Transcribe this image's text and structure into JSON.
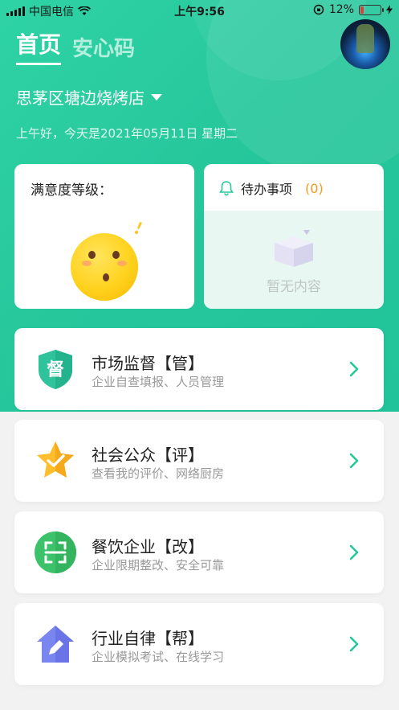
{
  "status_bar": {
    "carrier": "中国电信",
    "time": "上午9:56",
    "battery_pct": "12%"
  },
  "nav": {
    "home_label": "首页",
    "code_label": "安心码"
  },
  "header": {
    "store_name": "思茅区塘边烧烤店",
    "greeting": "上午好，今天是2021年05月11日 星期二"
  },
  "satisfaction": {
    "title": "满意度等级："
  },
  "todo": {
    "title": "待办事项",
    "count": "(0)",
    "empty_text": "暂无内容"
  },
  "menu": [
    {
      "title": "市场监督【管】",
      "subtitle": "企业自查填报、人员管理",
      "icon": "shield-supervise-icon"
    },
    {
      "title": "社会公众【评】",
      "subtitle": "查看我的评价、网络厨房",
      "icon": "star-check-icon"
    },
    {
      "title": "餐饮企业【改】",
      "subtitle": "企业限期整改、安全可靠",
      "icon": "scan-frame-icon"
    },
    {
      "title": "行业自律【帮】",
      "subtitle": "企业模拟考试、在线学习",
      "icon": "house-edit-icon"
    }
  ],
  "colors": {
    "brand_green": "#27c79c",
    "todo_count": "#f39a1e",
    "battery_low": "#e53935"
  }
}
